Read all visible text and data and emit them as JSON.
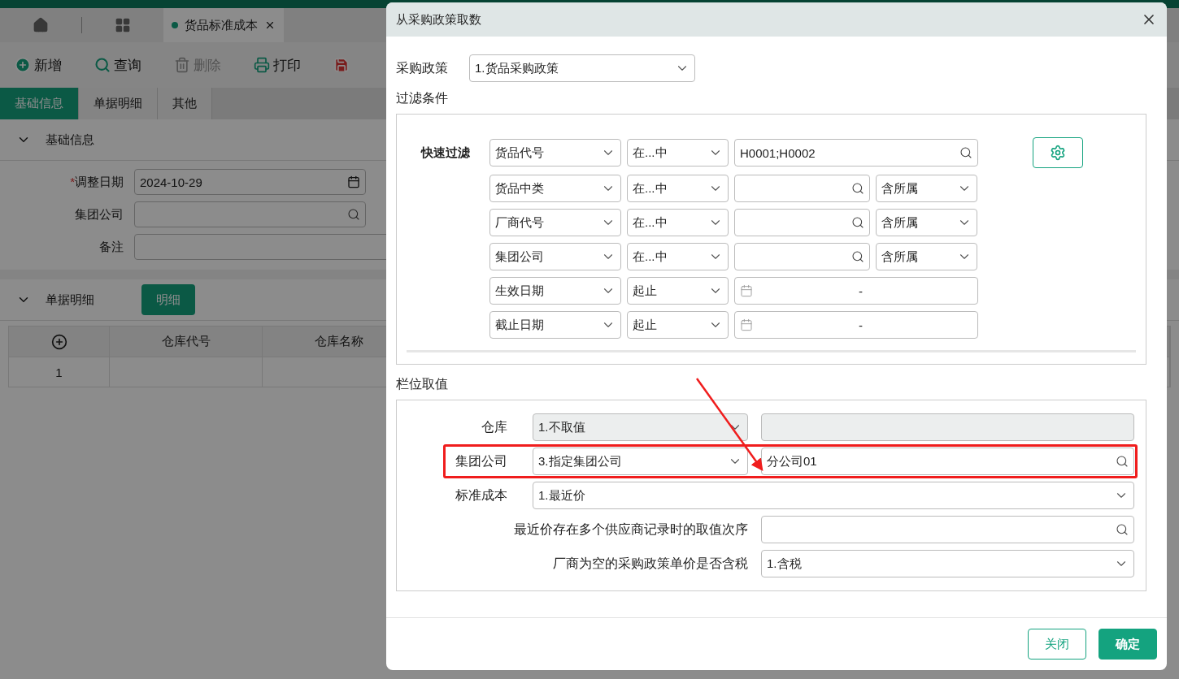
{
  "app": {
    "tabs": [
      {
        "label": "货品标准成本",
        "selected": true
      }
    ],
    "toolbar": [
      {
        "kind": "add",
        "label": "新增",
        "disabled": false
      },
      {
        "kind": "query",
        "label": "查询",
        "disabled": false
      },
      {
        "kind": "delete",
        "label": "删除",
        "disabled": true
      },
      {
        "kind": "print",
        "label": "打印",
        "disabled": false
      },
      {
        "kind": "save"
      }
    ],
    "section_tabs": [
      {
        "label": "基础信息",
        "selected": true
      },
      {
        "label": "单据明细",
        "selected": false
      },
      {
        "label": "其他",
        "selected": false
      }
    ],
    "basic_section": {
      "title": "基础信息",
      "expanded": true,
      "fields": [
        {
          "label": "调整日期",
          "required_mark": "*",
          "kind": "date",
          "value": "2024-10-29"
        },
        {
          "label": "集团公司",
          "kind": "lookup"
        },
        {
          "label": "备注",
          "kind": "text"
        }
      ]
    },
    "detail_section": {
      "title": "单据明细",
      "expanded": true,
      "button": "明细",
      "columns": [
        "仓库代号",
        "仓库名称"
      ],
      "rows": [
        {
          "index": "1"
        }
      ]
    }
  },
  "dialog": {
    "title": "从采购政策取数",
    "policy": {
      "label": "采购政策",
      "value": "1.货品采购政策"
    },
    "filter": {
      "title": "过滤条件",
      "quick_label": "快速过滤",
      "rows": [
        {
          "field": "货品代号",
          "operator": "在...中",
          "kind": "lookup",
          "value": "H0001;H0002"
        },
        {
          "field": "货品中类",
          "operator": "在...中",
          "kind": "lookup",
          "scope": "含所属"
        },
        {
          "field": "厂商代号",
          "operator": "在...中",
          "kind": "lookup",
          "scope": "含所属"
        },
        {
          "field": "集团公司",
          "operator": "在...中",
          "kind": "lookup",
          "scope": "含所属"
        },
        {
          "field": "生效日期",
          "operator": "起止",
          "kind": "date_range",
          "separator": "-"
        },
        {
          "field": "截止日期",
          "operator": "起止",
          "kind": "date_range",
          "separator": "-"
        }
      ]
    },
    "columns": {
      "title": "栏位取值",
      "rows": [
        {
          "kind": "pair",
          "label": "仓库",
          "select": "1.不取值",
          "second": {
            "disabled": true
          },
          "highlighted": false
        },
        {
          "kind": "pair",
          "label": "集团公司",
          "select": "3.指定集团公司",
          "second": {
            "disabled": false,
            "value": "分公司01"
          },
          "highlighted": true
        },
        {
          "kind": "wide",
          "label": "标准成本",
          "control": {
            "kind": "select",
            "value": "1.最近价"
          },
          "highlighted": false
        },
        {
          "kind": "long",
          "label": "最近价存在多个供应商记录时的取值次序",
          "control": {
            "kind": "lookup"
          },
          "highlighted": false
        },
        {
          "kind": "long",
          "label": "厂商为空的采购政策单价是否含税",
          "control": {
            "kind": "select",
            "value": "1.含税"
          },
          "highlighted": false
        }
      ]
    },
    "buttons": [
      {
        "kind": "secondary",
        "label": "关闭"
      },
      {
        "kind": "primary",
        "label": "确定"
      }
    ]
  }
}
